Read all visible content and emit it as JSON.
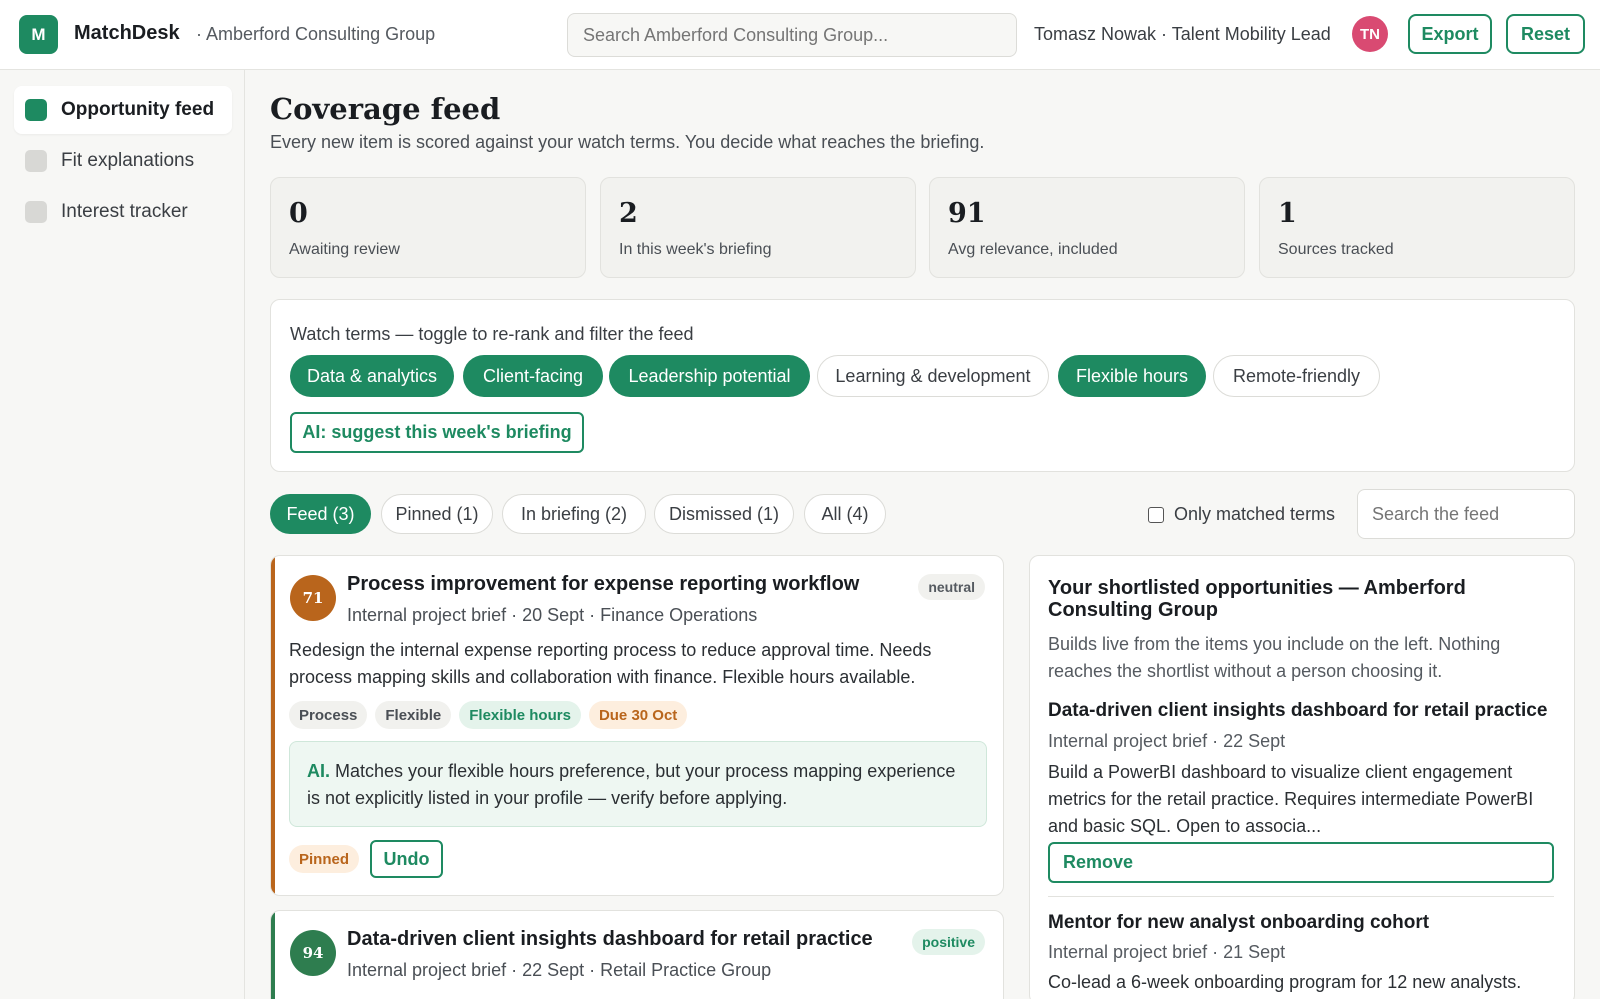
{
  "header": {
    "logo_letter": "M",
    "brand": "MatchDesk",
    "org": "· Amberford Consulting Group",
    "search_placeholder": "Search Amberford Consulting Group...",
    "user": "Tomasz Nowak · Talent Mobility Lead",
    "avatar_initials": "TN",
    "export_label": "Export",
    "reset_label": "Reset"
  },
  "sidebar": {
    "items": [
      {
        "label": "Opportunity feed",
        "active": true
      },
      {
        "label": "Fit explanations",
        "active": false
      },
      {
        "label": "Interest tracker",
        "active": false
      }
    ]
  },
  "main": {
    "title": "Coverage feed",
    "subtitle": "Every new item is scored against your watch terms. You decide what reaches the briefing.",
    "stats": [
      {
        "value": "0",
        "label": "Awaiting review"
      },
      {
        "value": "2",
        "label": "In this week's briefing"
      },
      {
        "value": "91",
        "label": "Avg relevance, included"
      },
      {
        "value": "1",
        "label": "Sources tracked"
      }
    ],
    "watch": {
      "label": "Watch terms — toggle to re-rank and filter the feed",
      "terms": [
        {
          "label": "Data & analytics",
          "on": true
        },
        {
          "label": "Client-facing",
          "on": true
        },
        {
          "label": "Leadership potential",
          "on": true
        },
        {
          "label": "Learning & development",
          "on": false
        },
        {
          "label": "Flexible hours",
          "on": true
        },
        {
          "label": "Remote-friendly",
          "on": false
        }
      ],
      "ai_button": "AI: suggest this week's briefing"
    },
    "tabs": [
      {
        "label": "Feed (3)",
        "active": true
      },
      {
        "label": "Pinned (1)",
        "active": false
      },
      {
        "label": "In briefing (2)",
        "active": false
      },
      {
        "label": "Dismissed (1)",
        "active": false
      },
      {
        "label": "All (4)",
        "active": false
      }
    ],
    "only_matched_label": "Only matched terms",
    "feed_search_placeholder": "Search the feed",
    "cards": [
      {
        "score": "71",
        "score_color": "#b9651c",
        "title": "Process improvement for expense reporting workflow",
        "meta": "Internal project brief · 20 Sept · Finance Operations",
        "sentiment": "neutral",
        "description": "Redesign the internal expense reporting process to reduce approval time. Needs process mapping skills and collaboration with finance. Flexible hours available.",
        "tags": [
          "Process",
          "Flexible",
          "Flexible hours",
          "Due 30 Oct"
        ],
        "ai_label": "AI.",
        "ai_text": "Matches your flexible hours preference, but your process mapping experience is not explicitly listed in your profile — verify before applying.",
        "status": "Pinned",
        "action": "Undo"
      },
      {
        "score": "94",
        "score_color": "#2e7d4f",
        "title": "Data-driven client insights dashboard for retail practice",
        "meta": "Internal project brief · 22 Sept · Retail Practice Group",
        "sentiment": "positive"
      }
    ],
    "shortlist": {
      "title": "Your shortlisted opportunities — Amberford Consulting Group",
      "description": "Builds live from the items you include on the left. Nothing reaches the shortlist without a person choosing it.",
      "items": [
        {
          "title": "Data-driven client insights dashboard for retail practice",
          "meta": "Internal project brief · 22 Sept",
          "description": "Build a PowerBI dashboard to visualize client engagement metrics for the retail practice. Requires intermediate PowerBI and basic SQL. Open to associa...",
          "remove_label": "Remove"
        },
        {
          "title": "Mentor for new analyst onboarding cohort",
          "meta": "Internal project brief · 21 Sept",
          "description": "Co-lead a 6-week onboarding program for 12 new analysts."
        }
      ]
    }
  },
  "colors": {
    "accent": "#1e8a61",
    "pinned": "#b9651c"
  }
}
